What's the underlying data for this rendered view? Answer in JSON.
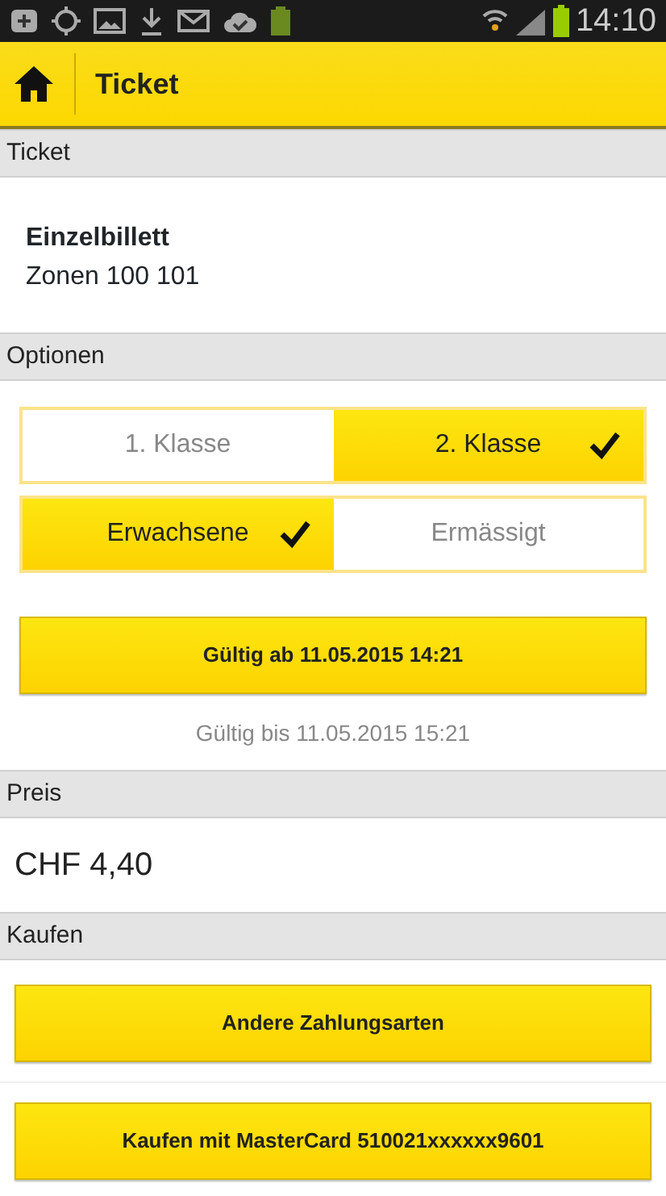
{
  "status_bar": {
    "time": "14:10"
  },
  "header": {
    "title": "Ticket"
  },
  "ticket_section": {
    "heading": "Ticket",
    "name": "Einzelbillett",
    "zones": "Zonen 100 101"
  },
  "options_section": {
    "heading": "Optionen",
    "groups": [
      {
        "options": [
          {
            "label": "1. Klasse",
            "selected": false
          },
          {
            "label": "2. Klasse",
            "selected": true
          }
        ]
      },
      {
        "options": [
          {
            "label": "Erwachsene",
            "selected": true
          },
          {
            "label": "Ermässigt",
            "selected": false
          }
        ]
      }
    ],
    "valid_from_button": "Gültig ab 11.05.2015 14:21",
    "valid_until": "Gültig bis 11.05.2015 15:21"
  },
  "price_section": {
    "heading": "Preis",
    "price": "CHF 4,40"
  },
  "buy_section": {
    "heading": "Kaufen",
    "buttons": [
      "Andere Zahlungsarten",
      "Kaufen mit MasterCard 510021xxxxxx9601"
    ]
  }
}
